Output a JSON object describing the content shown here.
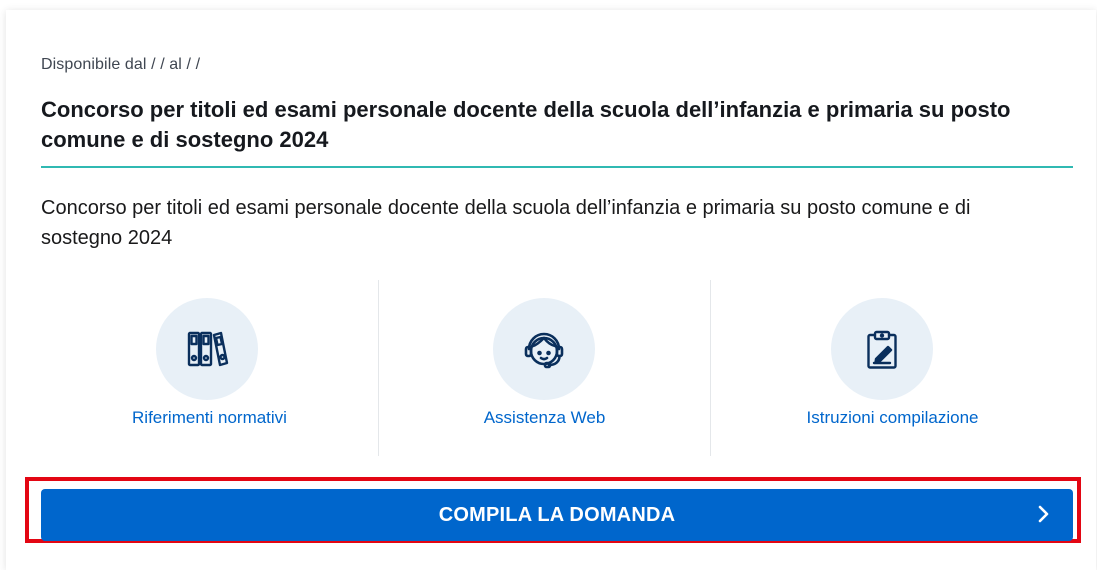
{
  "announcement": {
    "availability": "Disponibile dal   /  /      al   /  /",
    "title": "Concorso per titoli ed esami personale docente della scuola dell’infanzia e primaria su posto comune e di sostegno 2024",
    "description": "Concorso per titoli ed esami personale docente della scuola dell’infanzia e primaria su posto comune e di sostegno 2024"
  },
  "links": [
    {
      "label": "Riferimenti normativi",
      "icon": "binders-icon"
    },
    {
      "label": "Assistenza Web",
      "icon": "headset-support-icon"
    },
    {
      "label": "Istruzioni compilazione",
      "icon": "clipboard-edit-icon"
    }
  ],
  "action": {
    "label": "COMPILA LA DOMANDA",
    "icon": "chevron-right-icon"
  },
  "colors": {
    "accent_blue": "#0066cc",
    "title_rule": "#30b9b2",
    "highlight_border": "#e30613",
    "icon_circle": "#e8f0f7"
  }
}
